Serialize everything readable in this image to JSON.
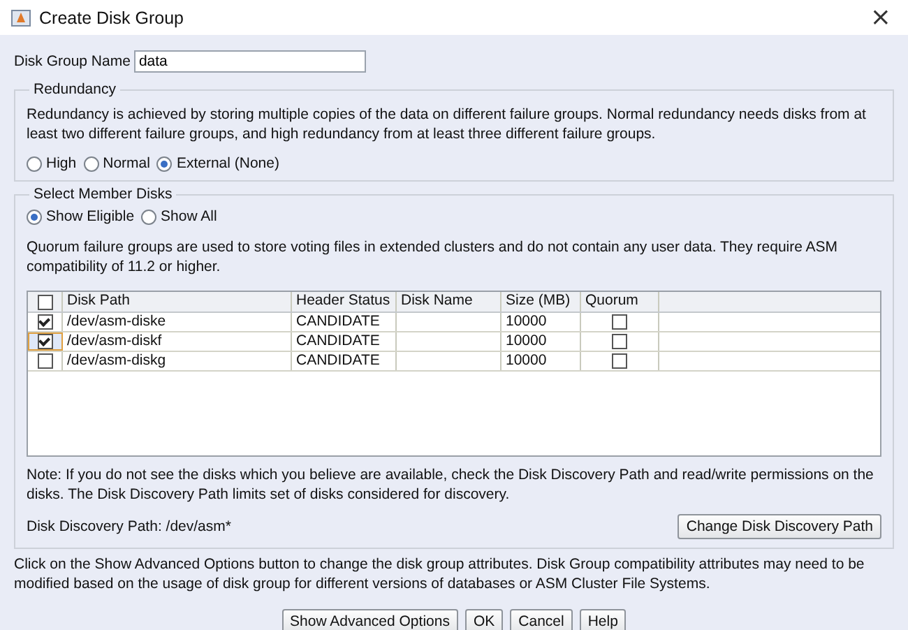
{
  "window": {
    "title": "Create Disk Group",
    "close": "×"
  },
  "name_field": {
    "label": "Disk Group Name",
    "value": "data"
  },
  "redundancy": {
    "legend": "Redundancy",
    "description": "Redundancy is achieved by storing multiple copies of the data on different failure groups. Normal redundancy needs disks from at least two different failure groups, and high redundancy from at least three different failure groups.",
    "options": [
      {
        "label": "High",
        "selected": false
      },
      {
        "label": "Normal",
        "selected": false
      },
      {
        "label": "External (None)",
        "selected": true
      }
    ]
  },
  "member_disks": {
    "legend": "Select Member Disks",
    "filters": [
      {
        "label": "Show Eligible",
        "selected": true
      },
      {
        "label": "Show All",
        "selected": false
      }
    ],
    "quorum_note": "Quorum failure groups are used to store voting files in extended clusters and do not contain any user data. They require ASM compatibility of 11.2 or higher.",
    "table": {
      "select_all_checked": false,
      "columns": [
        "Disk Path",
        "Header Status",
        "Disk Name",
        "Size (MB)",
        "Quorum"
      ],
      "rows": [
        {
          "checked": true,
          "focused": false,
          "path": "/dev/asm-diske",
          "status": "CANDIDATE",
          "size": "10000",
          "quorum": false
        },
        {
          "checked": true,
          "focused": true,
          "path": "/dev/asm-diskf",
          "status": "CANDIDATE",
          "size": "10000",
          "quorum": false
        },
        {
          "checked": false,
          "focused": false,
          "path": "/dev/asm-diskg",
          "status": "CANDIDATE",
          "size": "10000",
          "quorum": false
        }
      ]
    },
    "note": "Note: If you do not see the disks which you believe are available, check the Disk Discovery Path and read/write permissions on the disks. The Disk Discovery Path limits set of disks considered for discovery.",
    "discovery_path": "Disk Discovery Path: /dev/asm*",
    "change_button": "Change Disk Discovery Path"
  },
  "advanced_note": "Click on the Show Advanced Options button to change the disk group attributes. Disk Group compatibility attributes may need to be modified based on the usage of disk group for different versions of databases or ASM Cluster File Systems.",
  "buttons": [
    "Show Advanced Options",
    "OK",
    "Cancel",
    "Help"
  ]
}
